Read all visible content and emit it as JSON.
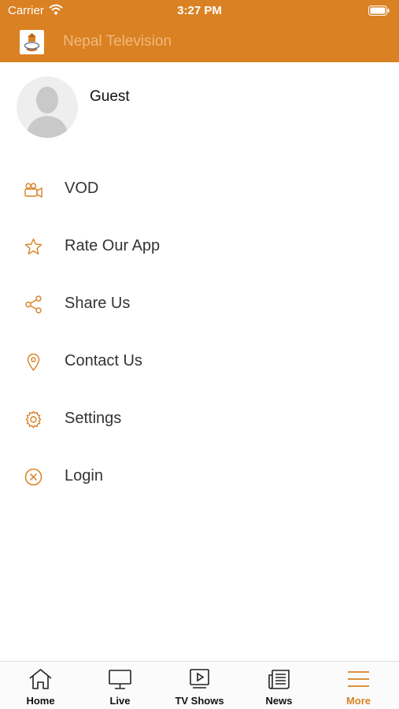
{
  "status_bar": {
    "carrier": "Carrier",
    "time": "3:27 PM"
  },
  "header": {
    "title": "Nepal Television",
    "bg_color": "#D98123"
  },
  "profile": {
    "name": "Guest"
  },
  "menu": {
    "items": [
      {
        "label": "VOD",
        "icon": "video-camera-icon"
      },
      {
        "label": "Rate Our App",
        "icon": "star-icon"
      },
      {
        "label": "Share Us",
        "icon": "share-icon"
      },
      {
        "label": "Contact Us",
        "icon": "location-pin-icon"
      },
      {
        "label": "Settings",
        "icon": "gear-icon"
      },
      {
        "label": "Login",
        "icon": "circle-x-icon"
      }
    ]
  },
  "tab_bar": {
    "tabs": [
      {
        "label": "Home",
        "icon": "home-icon"
      },
      {
        "label": "Live",
        "icon": "tv-icon"
      },
      {
        "label": "TV Shows",
        "icon": "play-screen-icon"
      },
      {
        "label": "News",
        "icon": "newspaper-icon"
      },
      {
        "label": "More",
        "icon": "hamburger-icon"
      }
    ],
    "active": "More",
    "accent_color": "#D98123"
  }
}
